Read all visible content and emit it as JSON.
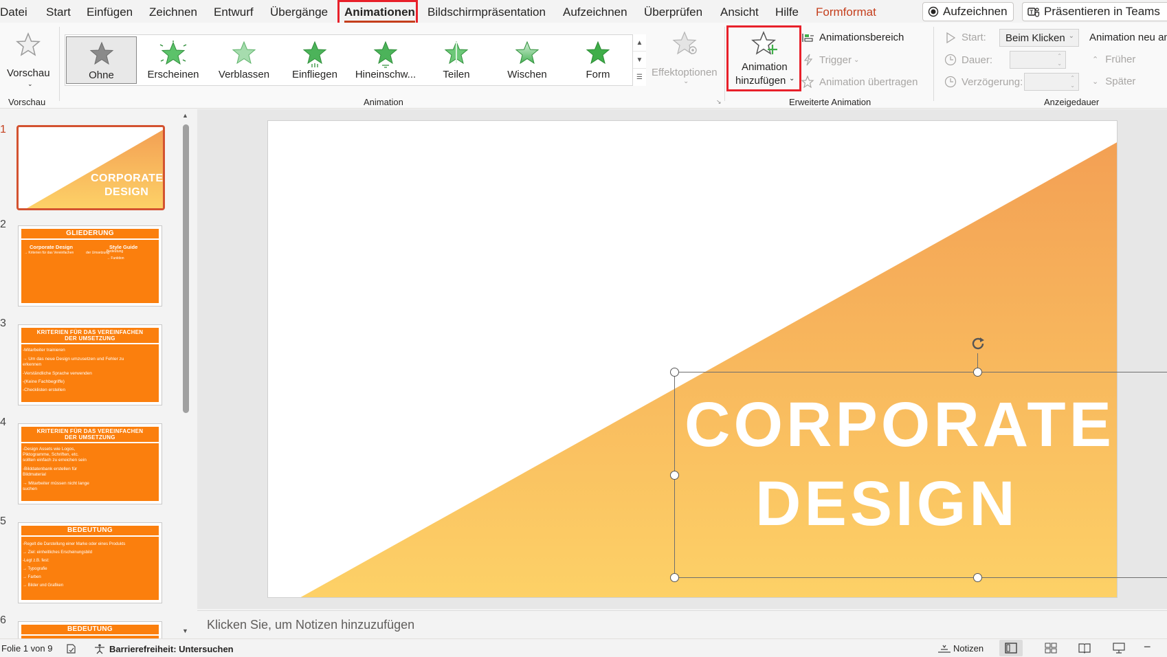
{
  "menu": {
    "items": [
      "Datei",
      "Start",
      "Einfügen",
      "Zeichnen",
      "Entwurf",
      "Übergänge",
      "Animationen",
      "Bildschirmpräsentation",
      "Aufzeichnen",
      "Überprüfen",
      "Ansicht",
      "Hilfe",
      "Formformat"
    ],
    "active": "Animationen",
    "record_button": "Aufzeichnen",
    "teams_button": "Präsentieren in Teams"
  },
  "ribbon": {
    "preview": {
      "label": "Vorschau",
      "group": "Vorschau"
    },
    "animation": {
      "group": "Animation",
      "effects": [
        "Ohne",
        "Erscheinen",
        "Verblassen",
        "Einfliegen",
        "Hineinschw...",
        "Teilen",
        "Wischen",
        "Form"
      ],
      "selected": "Ohne"
    },
    "effect_options": "Effektoptionen",
    "advanced": {
      "group": "Erweiterte Animation",
      "add_animation_line1": "Animation",
      "add_animation_line2": "hinzufügen",
      "pane": "Animationsbereich",
      "trigger": "Trigger",
      "painter": "Animation übertragen"
    },
    "timing": {
      "group": "Anzeigedauer",
      "start_label": "Start:",
      "start_value": "Beim Klicken",
      "duration_label": "Dauer:",
      "delay_label": "Verzögerung:",
      "reorder": "Animation neu an",
      "earlier": "Früher",
      "later": "Später"
    },
    "colors": {
      "accent": "#c43e1c",
      "highlight": "#e8202a",
      "star_green": "#3fae49"
    }
  },
  "thumbnails": {
    "numbers": [
      "1",
      "2",
      "3",
      "4",
      "5",
      "6"
    ],
    "slide1": {
      "line1": "CORPORATE",
      "line2": "DESIGN"
    },
    "slide2": {
      "title": "GLIEDERUNG",
      "col1": "Corporate Design",
      "col1_sub": "→ Kriterien für das Vereinfachen",
      "col2": "Style Guide",
      "col2_mid": "der Umsetzung",
      "col2_sub1": "Bedeutung",
      "col2_sub2": "→ Funktion"
    },
    "slide3": {
      "title1": "KRITERIEN FÜR DAS VEREINFACHEN",
      "title2": "DER UMSETZUNG",
      "lines": [
        "-Mitarbeiter trainieren",
        "→ Um das neue Design umzusetzen und Fehler zu",
        "erkennen",
        "-Verständliche Sprache verwenden",
        "-(Keine Fachbegriffe)",
        "-Checklisten erstellen"
      ]
    },
    "slide4": {
      "title1": "KRITERIEN FÜR DAS VEREINFACHEN",
      "title2": "DER UMSETZUNG",
      "lines": [
        "-Design Assets wie Logos,",
        "Piktogramme, Schriften, etc.",
        "sollten einfach zu erreichen sein",
        "-Bilddatenbank erstellen für",
        "Bildmaterial",
        "→ Mitarbeiter müssen nicht lange",
        "suchen"
      ]
    },
    "slide5": {
      "title": "BEDEUTUNG",
      "lines": [
        "-Regelt die Darstellung einer Marke oder eines Produkts",
        "→ Ziel: einheitliches Erscheinungsbild",
        "-Legt z.B. fest:",
        "→ Typografie",
        "→ Farben",
        "→ Bilder und Grafiken"
      ]
    },
    "slide6": {
      "title": "BEDEUTUNG"
    }
  },
  "slide": {
    "line1": "CORPORATE",
    "line2": "DESIGN",
    "gradient_top": "#f3a054",
    "gradient_bottom": "#fdd167"
  },
  "notes_placeholder": "Klicken Sie, um Notizen hinzuzufügen",
  "status": {
    "slide_of": "Folie 1 von 9",
    "accessibility": "Barrierefreiheit: Untersuchen",
    "notes": "Notizen"
  }
}
